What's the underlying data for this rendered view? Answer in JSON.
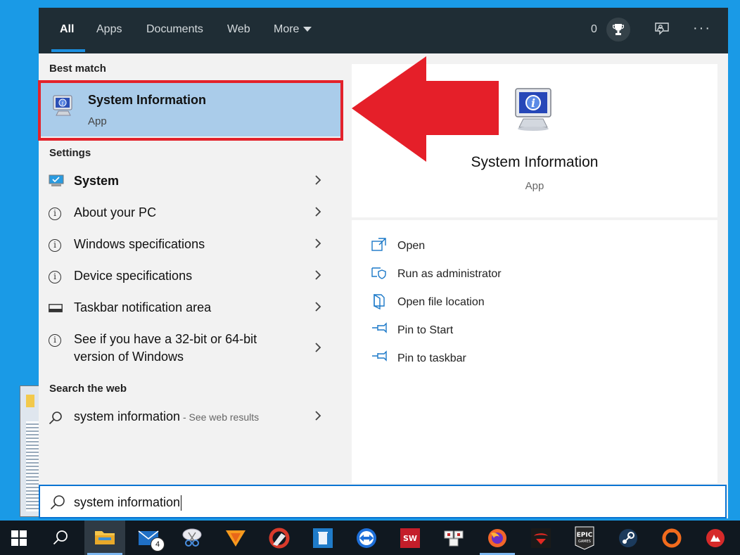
{
  "tabs": [
    {
      "label": "All",
      "active": true
    },
    {
      "label": "Apps"
    },
    {
      "label": "Documents"
    },
    {
      "label": "Web"
    },
    {
      "label": "More"
    }
  ],
  "header": {
    "points": "0"
  },
  "sections": {
    "best_match": "Best match",
    "settings": "Settings",
    "search_web": "Search the web"
  },
  "best_match": {
    "title": "System Information",
    "subtitle": "App"
  },
  "settings_items": [
    {
      "label": "System",
      "icon": "monitor-icon"
    },
    {
      "label": "About your PC",
      "icon": "info-icon"
    },
    {
      "label": "Windows specifications",
      "icon": "info-icon"
    },
    {
      "label": "Device specifications",
      "icon": "info-icon"
    },
    {
      "label": "Taskbar notification area",
      "icon": "taskbar-icon"
    },
    {
      "label_line1": "See if you have a 32-bit or 64-bit",
      "label_line2": "version of Windows",
      "icon": "info-icon"
    }
  ],
  "web_result": {
    "query": "system information",
    "suffix": " - See web results"
  },
  "preview": {
    "title": "System Information",
    "subtitle": "App"
  },
  "actions": [
    {
      "label": "Open",
      "icon": "open-icon"
    },
    {
      "label": "Run as administrator",
      "icon": "shield-icon"
    },
    {
      "label": "Open file location",
      "icon": "file-location-icon"
    },
    {
      "label": "Pin to Start",
      "icon": "pin-icon"
    },
    {
      "label": "Pin to taskbar",
      "icon": "pin-icon"
    }
  ],
  "search": {
    "value": "system information"
  },
  "taskbar": {
    "mail_badge": "4"
  },
  "colors": {
    "accent": "#0a74d2",
    "highlight": "#aaccea",
    "callout": "#e3222b",
    "header": "#1f2d35"
  }
}
